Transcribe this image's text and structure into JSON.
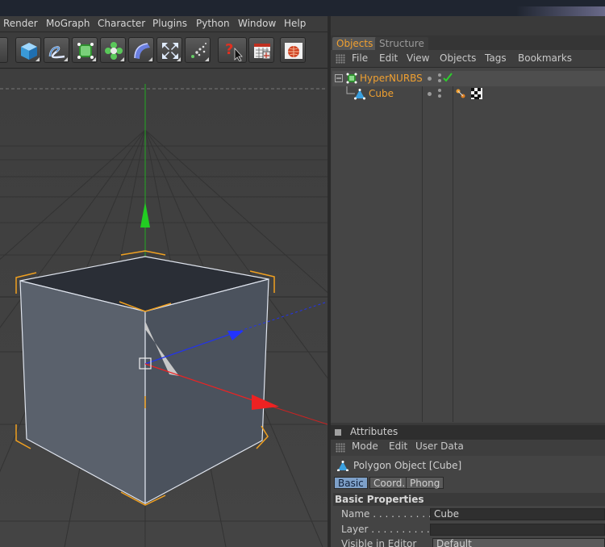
{
  "menubar": {
    "items": [
      "Render",
      "MoGraph",
      "Character",
      "Plugins",
      "Python",
      "Window",
      "Help"
    ]
  },
  "toolbar": {
    "tools": [
      "cube-primitive",
      "spline-tool",
      "nurbs-generator",
      "array-generator",
      "deformer",
      "scene-tool",
      "particle-emitter",
      "help-pointer",
      "timeline",
      "render-settings"
    ]
  },
  "object_manager": {
    "tabs": [
      "Objects",
      "Structure"
    ],
    "menu": [
      "File",
      "Edit",
      "View",
      "Objects",
      "Tags",
      "Bookmarks"
    ],
    "objects": [
      {
        "name": "HyperNURBS",
        "type": "hypernurbs-icon"
      },
      {
        "name": "Cube",
        "type": "polygon-icon"
      }
    ]
  },
  "attributes": {
    "header": "Attributes",
    "menu": [
      "Mode",
      "Edit",
      "User Data"
    ],
    "object_title": "Polygon Object [Cube]",
    "tabs": [
      "Basic",
      "Coord.",
      "Phong"
    ],
    "section_title": "Basic Properties",
    "properties": [
      {
        "label": "Name . . . . . . . . . . . .",
        "value": "Cube"
      },
      {
        "label": "Layer . . . . . . . . . . . .",
        "value": ""
      },
      {
        "label": "Visible in Editor",
        "value": "Default"
      }
    ]
  },
  "colors": {
    "accent_orange": "#f0a030",
    "selected_tab_blue": "#7ea0c8",
    "axis_y": "#22cc22",
    "axis_z": "#2233ff",
    "axis_x": "#ee2222"
  }
}
